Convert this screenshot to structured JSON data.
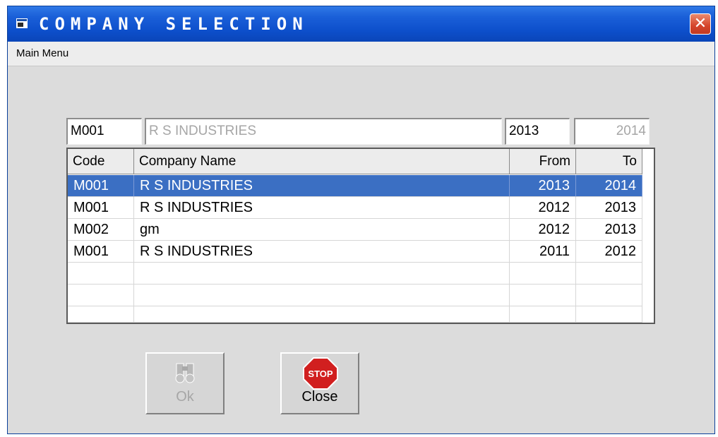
{
  "window": {
    "title": "COMPANY SELECTION",
    "close_glyph": "✕"
  },
  "menu": {
    "main_menu": "Main Menu"
  },
  "selected": {
    "code": "M001",
    "name": "R S INDUSTRIES",
    "from": "2013",
    "to": "2014"
  },
  "table": {
    "headers": {
      "code": "Code",
      "name": "Company Name",
      "from": "From",
      "to": "To"
    },
    "rows": [
      {
        "code": "M001",
        "name": "R S INDUSTRIES",
        "from": "2013",
        "to": "2014"
      },
      {
        "code": "M001",
        "name": "R S INDUSTRIES",
        "from": "2012",
        "to": "2013"
      },
      {
        "code": "M002",
        "name": "gm",
        "from": "2012",
        "to": "2013"
      },
      {
        "code": "M001",
        "name": "R S INDUSTRIES",
        "from": "2011",
        "to": "2012"
      }
    ]
  },
  "buttons": {
    "ok": "Ok",
    "close": "Close",
    "stop_sign": "STOP"
  },
  "colors": {
    "titlebar": "#0d4fcb",
    "selection": "#3b6fc3",
    "disabled_text": "#a6a6a6",
    "stop_red": "#d11f1f"
  }
}
